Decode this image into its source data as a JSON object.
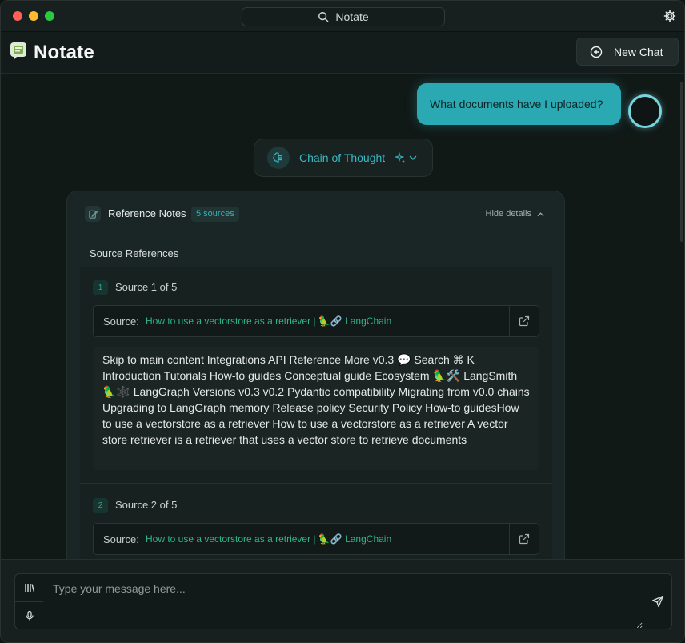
{
  "window": {
    "title": "Notate"
  },
  "header": {
    "app_title": "Notate",
    "new_chat_label": "New Chat"
  },
  "chat": {
    "user_message": "What documents have I uploaded?",
    "chain_of_thought_label": "Chain of Thought"
  },
  "references": {
    "title": "Reference Notes",
    "sources_badge": "5 sources",
    "hide_details_label": "Hide details",
    "section_title": "Source References",
    "sources": [
      {
        "number": "1",
        "label": "Source 1 of 5",
        "prefix": "Source:",
        "link": "How to use a vectorstore as a retriever | 🦜🔗 LangChain",
        "content": "Skip to main content Integrations API Reference More v0.3 💬 Search ⌘ K Introduction Tutorials How-to guides Conceptual guide Ecosystem 🦜🛠️ LangSmith 🦜🕸️ LangGraph Versions v0.3 v0.2 Pydantic compatibility Migrating from v0.0 chains Upgrading to LangGraph memory Release policy Security Policy How-to guidesHow to use a vectorstore as a retriever How to use a vectorstore as a retriever A vector store retriever is a retriever that uses a vector store to retrieve documents"
      },
      {
        "number": "2",
        "label": "Source 2 of 5",
        "prefix": "Source:",
        "link": "How to use a vectorstore as a retriever | 🦜🔗 LangChain"
      }
    ]
  },
  "input": {
    "placeholder": "Type your message here..."
  },
  "icons": {
    "search": "search-icon",
    "settings": "gear-icon",
    "logo": "notate-logo-icon",
    "new_chat": "plus-circle-icon",
    "brain": "brain-icon",
    "sparkle": "sparkle-icon",
    "chevron": "chevron-down-icon",
    "notes": "notes-icon",
    "chevron_up": "chevron-up-icon",
    "external": "external-link-icon",
    "library": "library-icon",
    "mic": "microphone-icon",
    "send": "send-icon"
  },
  "colors": {
    "accent": "#2aa9b2",
    "link": "#2fb488",
    "background": "#111917"
  }
}
